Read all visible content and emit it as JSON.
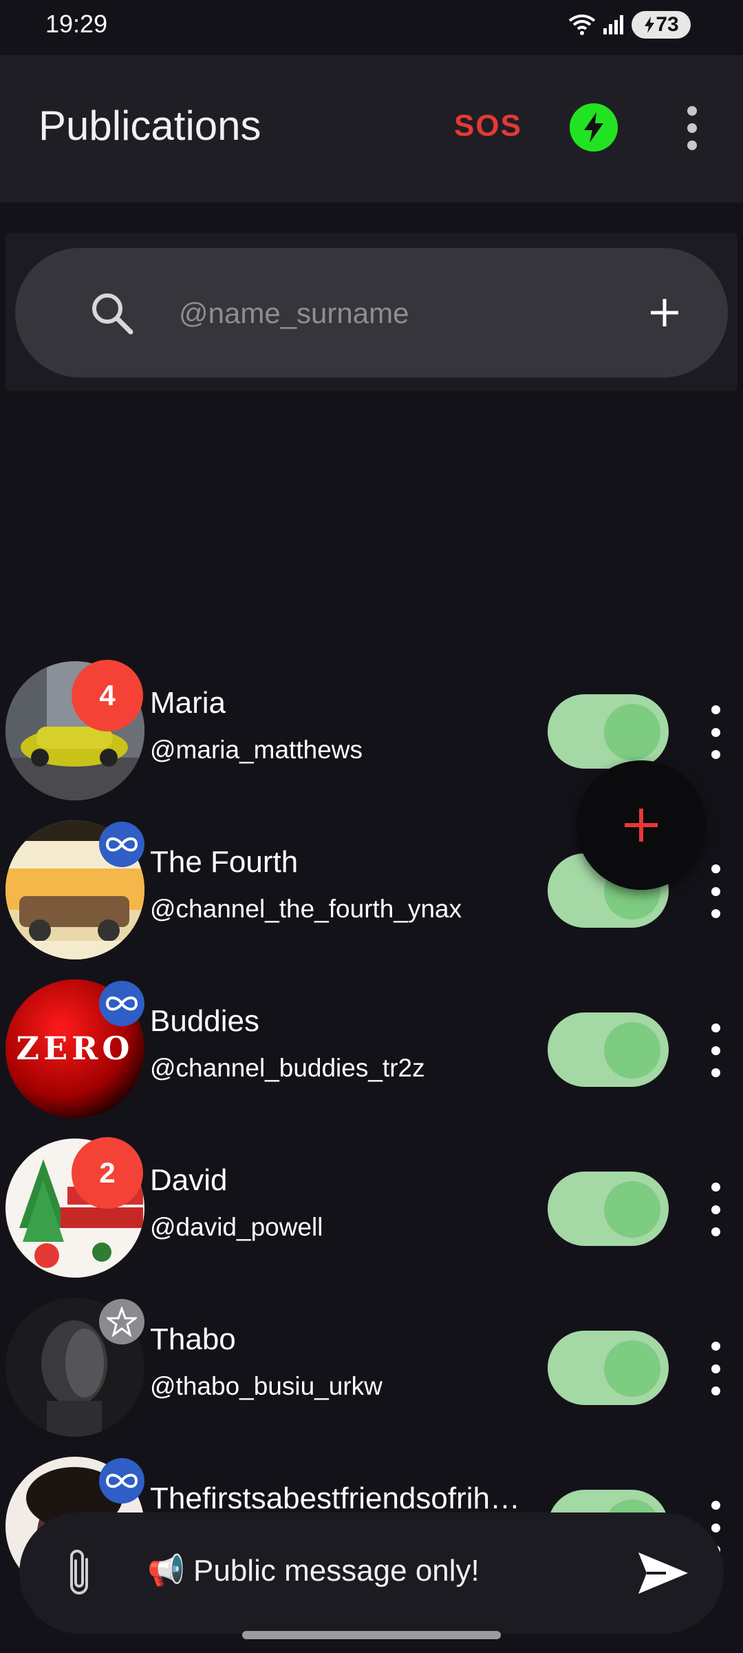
{
  "status_bar": {
    "time": "19:29",
    "battery": "73"
  },
  "app_bar": {
    "title": "Publications",
    "sos_label": "SOS"
  },
  "search": {
    "placeholder": "@name_surname",
    "value": ""
  },
  "contacts": [
    {
      "name": "Maria",
      "handle": "@maria_matthews",
      "badge": "4",
      "badge_type": "count",
      "toggle_on": true
    },
    {
      "name": "The Fourth",
      "handle": "@channel_the_fourth_ynax",
      "badge": "",
      "badge_type": "infinity",
      "toggle_on": true
    },
    {
      "name": "Buddies",
      "handle": "@channel_buddies_tr2z",
      "badge": "",
      "badge_type": "infinity",
      "toggle_on": true
    },
    {
      "name": "David",
      "handle": "@david_powell",
      "badge": "2",
      "badge_type": "count",
      "toggle_on": true
    },
    {
      "name": "Thabo",
      "handle": "@thabo_busiu_urkw",
      "badge": "",
      "badge_type": "star",
      "toggle_on": true
    },
    {
      "name": "Thefirstsabestfriendsofrih…",
      "handle": "",
      "badge": "",
      "badge_type": "infinity",
      "toggle_on": true
    }
  ],
  "avatar_art": {
    "buddies_text": "ZERO"
  },
  "composer": {
    "text": "📢 Public message only!"
  },
  "colors": {
    "background": "#141219",
    "app_bar": "#1f1e24",
    "sos": "#e53935",
    "bolt_button": "#22e322",
    "badge_red": "#f44336",
    "badge_blue": "#2f5ec6",
    "toggle_track": "#a4d8a5",
    "toggle_knob": "#7ecb82",
    "fab_plus": "#e53935"
  },
  "icons": {
    "status": [
      "wifi-icon",
      "signal-icon",
      "battery-icon"
    ],
    "app_bar": [
      "bolt-icon",
      "more-vert-icon"
    ],
    "search": [
      "search-icon",
      "add-icon"
    ],
    "row": [
      "more-vert-icon"
    ],
    "composer": [
      "attach-icon",
      "send-icon"
    ],
    "fab": "plus-icon"
  }
}
